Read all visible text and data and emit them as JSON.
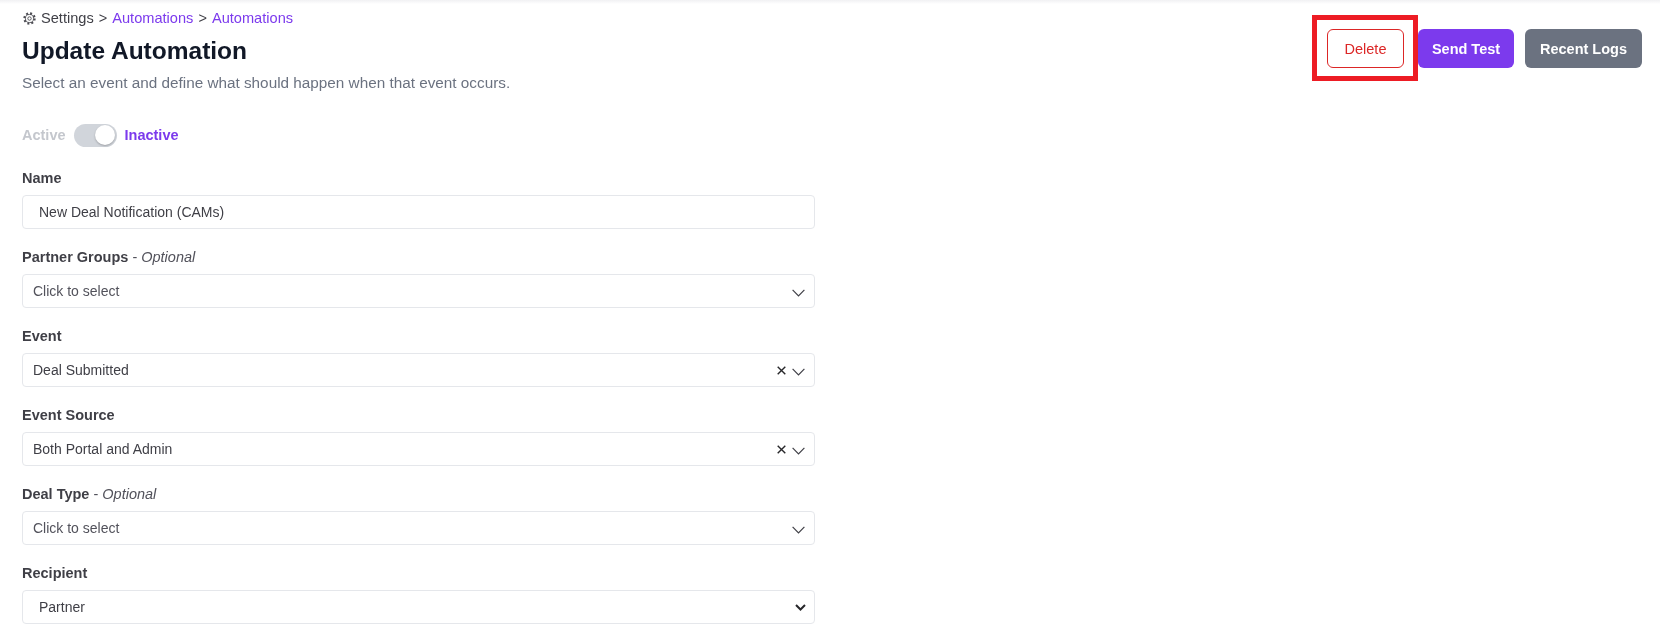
{
  "breadcrumb": [
    {
      "label": "Settings",
      "link": false
    },
    {
      "separator": ">",
      "label": "Automations",
      "link": true
    },
    {
      "separator": ">",
      "label": "Automations",
      "link": true
    }
  ],
  "title": "Update Automation",
  "subtitle": "Select an event and define what should happen when that event occurs.",
  "actions": [
    {
      "label": "Delete",
      "kind": "danger",
      "highlighted": true
    },
    {
      "label": "Send Test",
      "kind": "primary",
      "highlighted": false
    },
    {
      "label": "Recent Logs",
      "kind": "secondary",
      "highlighted": false
    }
  ],
  "status_toggle": {
    "options": [
      {
        "label": "Active",
        "selected": false
      },
      {
        "label": "Inactive",
        "selected": true
      }
    ]
  },
  "fields": [
    {
      "kind": "text",
      "label": "Name",
      "value": "New Deal Notification (CAMs)"
    },
    {
      "kind": "select",
      "label": "Partner Groups",
      "note": "- *Optional*",
      "placeholder": "Click to select",
      "clearable": false
    },
    {
      "kind": "select",
      "label": "Event",
      "value": "Deal Submitted",
      "clearable": true
    },
    {
      "kind": "select",
      "label": "Event Source",
      "value": "Both Portal and Admin",
      "clearable": true
    },
    {
      "kind": "select",
      "label": "Deal Type",
      "note": "- *Optional*",
      "placeholder": "Click to select",
      "clearable": false
    },
    {
      "kind": "native_select",
      "label": "Recipient",
      "value": "Partner"
    }
  ]
}
